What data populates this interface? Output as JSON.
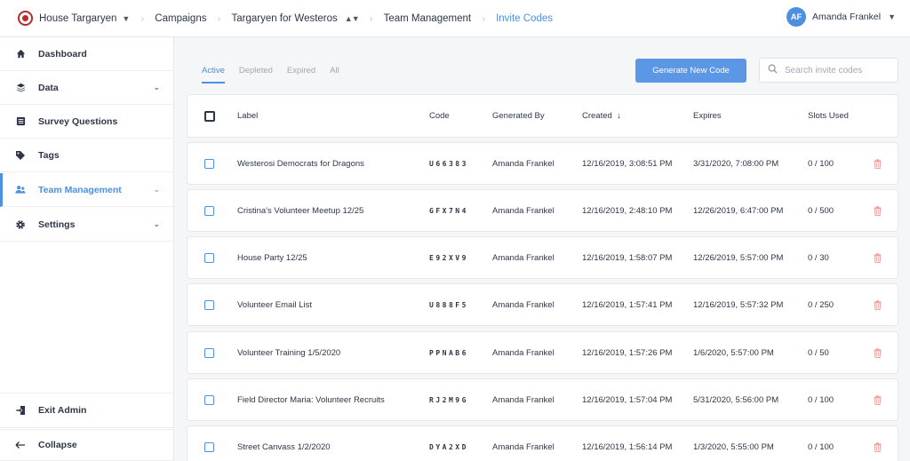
{
  "breadcrumbs": {
    "org": "House Targaryen",
    "campaigns": "Campaigns",
    "campaign": "Targaryen for Westeros",
    "team": "Team Management",
    "current": "Invite Codes"
  },
  "user": {
    "initials": "AF",
    "name": "Amanda Frankel"
  },
  "sidebar": {
    "items": [
      {
        "label": "Dashboard",
        "icon": "home-icon"
      },
      {
        "label": "Data",
        "icon": "layers-icon"
      },
      {
        "label": "Survey Questions",
        "icon": "list-icon"
      },
      {
        "label": "Tags",
        "icon": "tags-icon"
      },
      {
        "label": "Team Management",
        "icon": "team-icon"
      },
      {
        "label": "Settings",
        "icon": "gear-icon"
      }
    ],
    "exit": "Exit Admin",
    "collapse": "Collapse"
  },
  "tabs": [
    "Active",
    "Depleted",
    "Expired",
    "All"
  ],
  "generate_button": "Generate New Code",
  "search": {
    "placeholder": "Search invite codes"
  },
  "columns": [
    "Label",
    "Code",
    "Generated By",
    "Created",
    "Expires",
    "Slots Used"
  ],
  "rows": [
    {
      "label": "Westerosi Democrats for Dragons",
      "code": "U66383",
      "generated_by": "Amanda Frankel",
      "created": "12/16/2019, 3:08:51 PM",
      "expires": "3/31/2020, 7:08:00 PM",
      "slots": "0 / 100"
    },
    {
      "label": "Cristina's Volunteer Meetup 12/25",
      "code": "GFX7N4",
      "generated_by": "Amanda Frankel",
      "created": "12/16/2019, 2:48:10 PM",
      "expires": "12/26/2019, 6:47:00 PM",
      "slots": "0 / 500"
    },
    {
      "label": "House Party 12/25",
      "code": "E92XV9",
      "generated_by": "Amanda Frankel",
      "created": "12/16/2019, 1:58:07 PM",
      "expires": "12/26/2019, 5:57:00 PM",
      "slots": "0 / 30"
    },
    {
      "label": "Volunteer Email List",
      "code": "U888F5",
      "generated_by": "Amanda Frankel",
      "created": "12/16/2019, 1:57:41 PM",
      "expires": "12/16/2019, 5:57:32 PM",
      "slots": "0 / 250"
    },
    {
      "label": "Volunteer Training 1/5/2020",
      "code": "PPNAB6",
      "generated_by": "Amanda Frankel",
      "created": "12/16/2019, 1:57:26 PM",
      "expires": "1/6/2020, 5:57:00 PM",
      "slots": "0 / 50"
    },
    {
      "label": "Field Director Maria: Volunteer Recruits",
      "code": "RJ2M9G",
      "generated_by": "Amanda Frankel",
      "created": "12/16/2019, 1:57:04 PM",
      "expires": "5/31/2020, 5:56:00 PM",
      "slots": "0 / 100"
    },
    {
      "label": "Street Canvass 1/2/2020",
      "code": "DYA2XD",
      "generated_by": "Amanda Frankel",
      "created": "12/16/2019, 1:56:14 PM",
      "expires": "1/3/2020, 5:55:00 PM",
      "slots": "0 / 100"
    }
  ],
  "colors": {
    "accent": "#4d8fe0",
    "button": "#5b97e5",
    "delete": "#f0a0a0",
    "brand": "#b52b2b"
  }
}
